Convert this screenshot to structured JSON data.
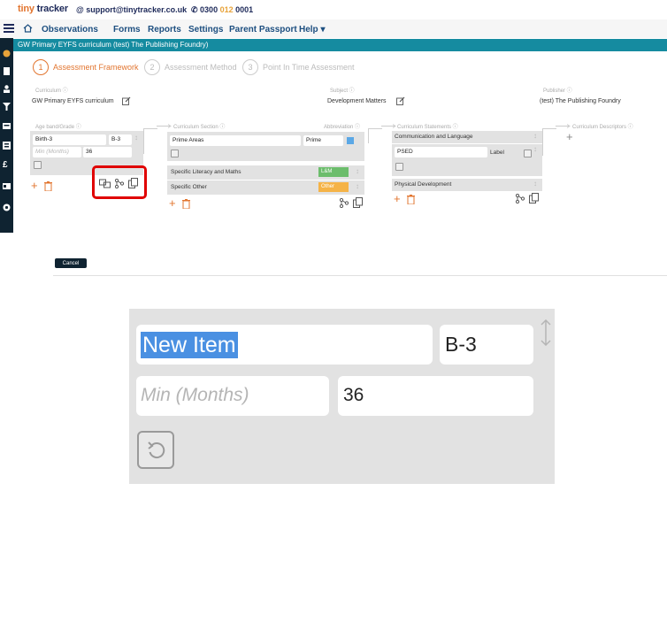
{
  "header": {
    "logo_tiny": "tiny",
    "logo_tracker": "tracker",
    "email": "support@tinytracker.co.uk",
    "phone_a": "0300 ",
    "phone_b": "012",
    "phone_c": " 0001"
  },
  "nav": {
    "items": [
      "Observations",
      "Forms",
      "Reports",
      "Settings",
      "Parent Passport",
      "Help ▾"
    ]
  },
  "banner": "GW Primary EYFS curriculum (test) The Publishing Foundry)",
  "steps": [
    {
      "number": "1",
      "label": "Assessment Framework"
    },
    {
      "number": "2",
      "label": "Assessment Method"
    },
    {
      "number": "3",
      "label": "Point In Time Assessment"
    }
  ],
  "info": {
    "curriculum_label": "Curriculum ⓘ",
    "curriculum_value": "GW Primary EYFS curriculum",
    "subject_label": "Subject ⓘ",
    "subject_value": "Development Matters",
    "publisher_label": "Publisher ⓘ",
    "publisher_value": "(test) The Publishing Foundry"
  },
  "columns": {
    "age_band": "Age band/Grade ⓘ",
    "section": "Curriculum Section ⓘ",
    "abbreviation": "Abbreviation ⓘ",
    "statements": "Curriculum Statements ⓘ",
    "descriptors": "Curriculum Descriptors ⓘ"
  },
  "age_band": {
    "name": "Birth-3",
    "abbr": "B-3",
    "min_placeholder": "Min (Months)",
    "min_value": "36"
  },
  "sections": {
    "editing_name": "Prime Areas",
    "editing_abbr": "Prime",
    "rows": [
      {
        "name": "Specific Literacy and Maths",
        "abbr": "L&M",
        "color": "#6cbd6c"
      },
      {
        "name": "Specific Other",
        "abbr": "Other",
        "color": "#f5b347"
      }
    ]
  },
  "statements": {
    "first": "Communication and Language",
    "editing_name": "PSED",
    "editing_label": "Label",
    "last": "Physical Development"
  },
  "cancel_label": "Cancel",
  "zoom": {
    "name_value": "New Item",
    "abbr_value": "B-3",
    "min_placeholder": "Min (Months)",
    "min_value": "36"
  },
  "colors": {
    "accent": "#e2752f",
    "navy": "#1e2a5a",
    "teal": "#158ba0",
    "sidebar": "#0f2331",
    "highlight": "#e00000"
  }
}
